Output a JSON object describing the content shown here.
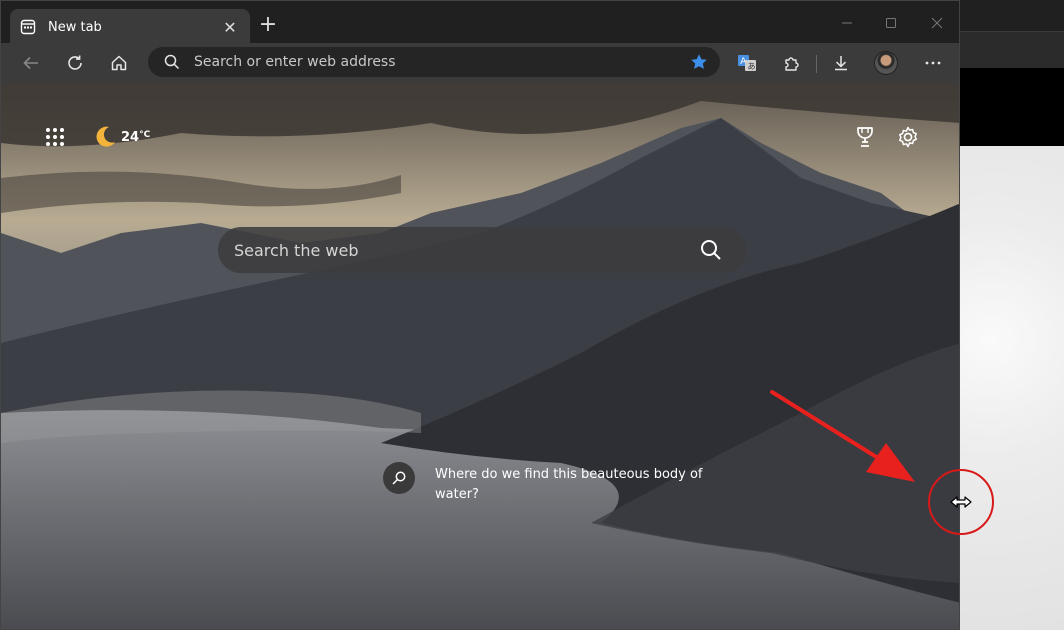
{
  "tab": {
    "title": "New tab",
    "close_label": "✕"
  },
  "new_tab_label": "+",
  "window_controls": {
    "minimize": "—",
    "maximize": "☐",
    "close": "✕"
  },
  "address_bar": {
    "placeholder": "Search or enter web address",
    "value": ""
  },
  "toolbar_icons": [
    "back-icon",
    "refresh-icon",
    "home-icon",
    "search-icon",
    "favorite-star-icon",
    "translate-icon",
    "extensions-icon",
    "downloads-icon",
    "profile-avatar",
    "more-icon"
  ],
  "new_tab_page": {
    "weather": {
      "temperature": "24",
      "unit": "°C"
    },
    "search": {
      "placeholder": "Search the web"
    },
    "image_query": "Where do we find this beauteous body of water?"
  },
  "annotation": {
    "arrow_color": "#e8201e",
    "circle_color": "#d8191a"
  },
  "colors": {
    "accent_blue": "#3b8eea",
    "toolbar": "#3b3b3b",
    "titlebar": "#202020"
  }
}
